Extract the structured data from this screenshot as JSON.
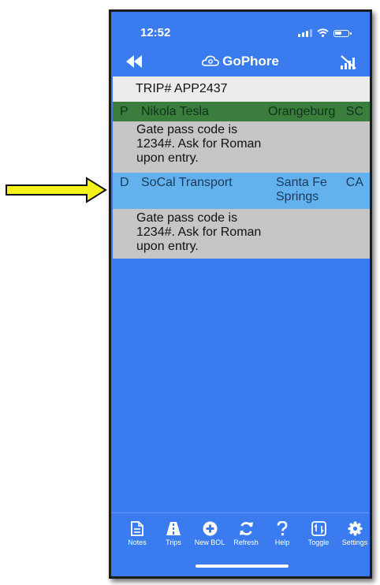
{
  "status": {
    "time": "12:52"
  },
  "nav": {
    "title": "GoPhore"
  },
  "trip": {
    "label": "TRIP# APP2437"
  },
  "stops": [
    {
      "code": "P",
      "name": "Nikola Tesla",
      "city": "Orangeburg",
      "state": "SC",
      "note": "Gate pass code is 1234#. Ask for Roman upon entry.",
      "color": "#3a7d3c"
    },
    {
      "code": "D",
      "name": "SoCal Transport",
      "city": "Santa Fe Springs",
      "state": "CA",
      "note": "Gate pass code is 1234#. Ask for Roman upon entry.",
      "color": "#63b2ed"
    }
  ],
  "tabs": [
    {
      "label": "Notes",
      "icon": "notes-icon"
    },
    {
      "label": "Trips",
      "icon": "road-icon"
    },
    {
      "label": "New BOL",
      "icon": "plus-circle-icon"
    },
    {
      "label": "Refresh",
      "icon": "refresh-icon"
    },
    {
      "label": "Help",
      "icon": "question-icon"
    },
    {
      "label": "Toggle",
      "icon": "toggle-icon"
    },
    {
      "label": "Settings",
      "icon": "gear-icon"
    }
  ],
  "colors": {
    "background": "#3a7cf0",
    "arrow": "#f5f21a",
    "trip_bar": "#ececec",
    "note_bg": "#c6c6c6"
  }
}
